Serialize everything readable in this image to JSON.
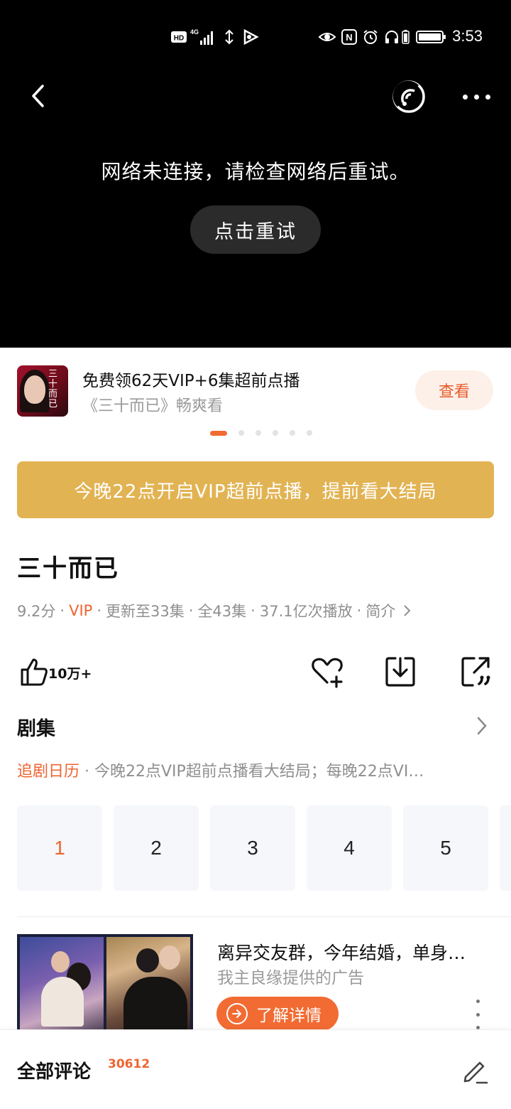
{
  "status_bar": {
    "time": "3:53",
    "hd_label": "HD",
    "network_label": "4G",
    "nfc_label": "N",
    "icons": [
      "hd-icon",
      "signal-icon",
      "data-icon",
      "play-icon",
      "eye-icon",
      "nfc-icon",
      "alarm-icon",
      "headphones-icon",
      "battery-small-icon",
      "battery-icon"
    ]
  },
  "player": {
    "error_message": "网络未连接，请检查网络后重试。",
    "retry_label": "点击重试",
    "icons": [
      "back-icon",
      "cast-icon",
      "more-icon"
    ]
  },
  "promo": {
    "title": "免费领62天VIP+6集超前点播",
    "subtitle": "《三十而已》畅爽看",
    "button_label": "查看",
    "thumb_text": "三十而已",
    "carousel_count": 6,
    "carousel_active": 0
  },
  "notice": {
    "text": "今晚22点开启VIP超前点播，提前看大结局"
  },
  "show": {
    "title": "三十而已",
    "score": "9.2分",
    "vip": "VIP",
    "update": "更新至33集",
    "total": "全43集",
    "plays": "37.1亿次播放",
    "intro_label": "简介",
    "separator": "·"
  },
  "actions": {
    "like_count": "10万+",
    "icons": [
      "thumbs-up-icon",
      "favorite-add-icon",
      "download-icon",
      "share-icon"
    ]
  },
  "episodes": {
    "section_title": "剧集",
    "calendar_label": "追剧日历",
    "calendar_text": " · 今晚22点VIP超前点播看大结局；每晚22点VI…",
    "items": [
      "1",
      "2",
      "3",
      "4",
      "5"
    ],
    "active_index": 0
  },
  "ad": {
    "title": "离异交友群，今年结婚，单身…",
    "subtitle": "我主良缘提供的广告",
    "button_label": "了解详情"
  },
  "comments": {
    "title": "全部评论",
    "count": "30612"
  },
  "colors": {
    "accent": "#ef6431",
    "notice_bg": "#e2b353",
    "player_bg": "#000000",
    "episode_bg": "#f5f7fa"
  }
}
